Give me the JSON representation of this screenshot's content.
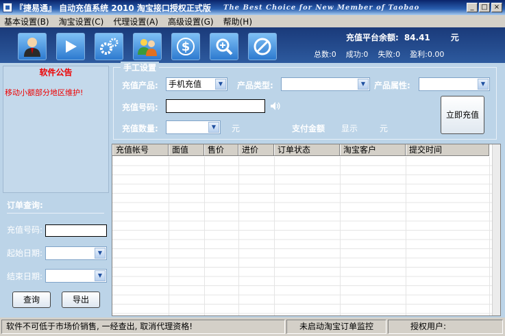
{
  "window": {
    "title": "『捷易通』 自动充值系统 2010 淘宝接口授权正式版",
    "subtitle": "The Best Choice for New Member of Taobao",
    "min": "_",
    "max": "□",
    "close": "×"
  },
  "menu": [
    "基本设置(B)",
    "淘宝设置(C)",
    "代理设置(A)",
    "高级设置(G)",
    "帮助(H)"
  ],
  "toolbar": {
    "icons": [
      "user-icon",
      "play-icon",
      "gears-icon",
      "users-icon",
      "dollar-icon",
      "zoom-in-icon",
      "forbid-icon"
    ],
    "balance_label": "充值平台余额:",
    "balance_value": "84.41",
    "balance_unit": "元",
    "stats": {
      "total": "总数:0",
      "success": "成功:0",
      "fail": "失败:0",
      "profit": "盈利:0.00"
    }
  },
  "notice": {
    "title": "软件公告",
    "text": "移动小额部分地区维护!"
  },
  "order_query": {
    "title": "订单查询:",
    "phone_label": "充值号码:",
    "start_label": "起始日期:",
    "end_label": "结束日期:",
    "query_button": "查询",
    "export_button": "导出"
  },
  "manual": {
    "legend": "手工设置",
    "product_label": "充值产品:",
    "product_value": "手机充值",
    "type_label": "产品类型:",
    "attr_label": "产品属性:",
    "phone_label": "充值号码:",
    "qty_label": "充值数量:",
    "qty_unit": "元",
    "pay_label": "支付金额",
    "pay_value": "显示",
    "pay_unit": "元",
    "recharge_button": "立即充值"
  },
  "table": {
    "columns": [
      "充值帐号",
      "面值",
      "售价",
      "进价",
      "订单状态",
      "淘宝客户",
      "提交时间"
    ]
  },
  "statusbar": {
    "warning": "软件不可低于市场价销售, 一经查出, 取消代理资格!",
    "monitor": "未启动淘宝订单监控",
    "user": "授权用户:"
  }
}
